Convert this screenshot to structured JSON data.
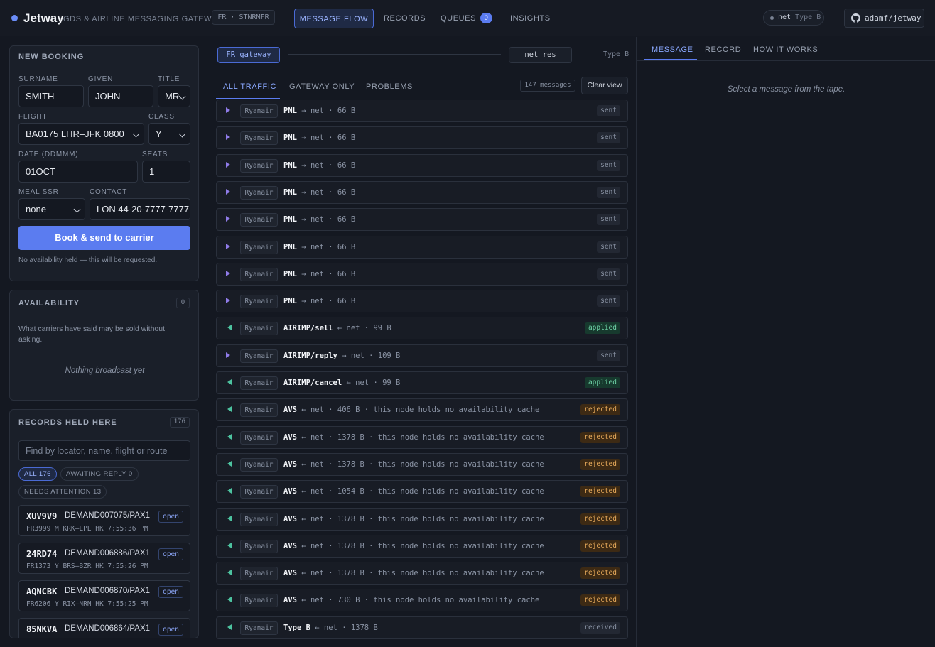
{
  "header": {
    "brand": "Jetway",
    "subtitle": "GDS & AIRLINE MESSAGING GATEWAY",
    "node": "FR · STNRMFR",
    "nav": [
      {
        "label": "MESSAGE FLOW",
        "active": true
      },
      {
        "label": "RECORDS"
      },
      {
        "label": "QUEUES",
        "badge": "0"
      },
      {
        "label": "INSIGHTS"
      }
    ],
    "net_label": "net",
    "net_type": "Type B",
    "repo": "adamf/jetway"
  },
  "new_booking": {
    "title": "NEW BOOKING",
    "surname_label": "SURNAME",
    "surname": "SMITH",
    "given_label": "GIVEN",
    "given": "JOHN",
    "title_label": "TITLE",
    "title_value": "MR",
    "flight_label": "FLIGHT",
    "flight": "BA0175 LHR–JFK 0800",
    "class_label": "CLASS",
    "class_value": "Y",
    "date_label": "DATE (DDMMM)",
    "date": "01OCT",
    "seats_label": "SEATS",
    "seats": "1",
    "meal_label": "MEAL SSR",
    "meal": "none",
    "contact_label": "CONTACT",
    "contact": "LON 44-20-7777-7777",
    "submit": "Book & send to carrier",
    "hint": "No availability held — this will be requested."
  },
  "availability": {
    "title": "AVAILABILITY",
    "count": "0",
    "description": "What carriers have said may be sold without asking.",
    "empty": "Nothing broadcast yet"
  },
  "records": {
    "title": "RECORDS HELD HERE",
    "count": "176",
    "search_placeholder": "Find by locator, name, flight or route",
    "filters": [
      {
        "label": "ALL",
        "count": "176",
        "active": true
      },
      {
        "label": "AWAITING REPLY",
        "count": "0"
      },
      {
        "label": "NEEDS ATTENTION",
        "count": "13"
      }
    ],
    "items": [
      {
        "locator": "XUV9V9",
        "name": "DEMAND007075/PAX1",
        "detail": "FR3999 M KRK–LPL HK  7:55:36 PM",
        "status": "open"
      },
      {
        "locator": "24RD74",
        "name": "DEMAND006886/PAX1",
        "detail": "FR1373 Y BRS–BZR HK  7:55:26 PM",
        "status": "open"
      },
      {
        "locator": "AQNCBK",
        "name": "DEMAND006870/PAX1",
        "detail": "FR6206 Y RIX–NRN HK  7:55:25 PM",
        "status": "open"
      },
      {
        "locator": "85NKVA",
        "name": "DEMAND006864/PAX1",
        "detail": "",
        "status": "open"
      }
    ]
  },
  "flow": {
    "gateway": "FR gateway",
    "res": "net res",
    "type": "Type B",
    "tabs": [
      {
        "label": "ALL TRAFFIC",
        "active": true
      },
      {
        "label": "GATEWAY ONLY"
      },
      {
        "label": "PROBLEMS"
      }
    ],
    "message_count": "147 messages",
    "clear": "Clear view",
    "messages": [
      {
        "dir": "out",
        "carrier": "Ryanair",
        "kind": "PNL",
        "detail": "→ net · 66 B",
        "status": "sent"
      },
      {
        "dir": "out",
        "carrier": "Ryanair",
        "kind": "PNL",
        "detail": "→ net · 66 B",
        "status": "sent"
      },
      {
        "dir": "out",
        "carrier": "Ryanair",
        "kind": "PNL",
        "detail": "→ net · 66 B",
        "status": "sent"
      },
      {
        "dir": "out",
        "carrier": "Ryanair",
        "kind": "PNL",
        "detail": "→ net · 66 B",
        "status": "sent"
      },
      {
        "dir": "out",
        "carrier": "Ryanair",
        "kind": "PNL",
        "detail": "→ net · 66 B",
        "status": "sent"
      },
      {
        "dir": "out",
        "carrier": "Ryanair",
        "kind": "PNL",
        "detail": "→ net · 66 B",
        "status": "sent"
      },
      {
        "dir": "out",
        "carrier": "Ryanair",
        "kind": "PNL",
        "detail": "→ net · 66 B",
        "status": "sent"
      },
      {
        "dir": "out",
        "carrier": "Ryanair",
        "kind": "PNL",
        "detail": "→ net · 66 B",
        "status": "sent"
      },
      {
        "dir": "in",
        "carrier": "Ryanair",
        "kind": "AIRIMP/sell",
        "detail": "← net · 99 B",
        "status": "applied"
      },
      {
        "dir": "out",
        "carrier": "Ryanair",
        "kind": "AIRIMP/reply",
        "detail": "→ net · 109 B",
        "status": "sent"
      },
      {
        "dir": "in",
        "carrier": "Ryanair",
        "kind": "AIRIMP/cancel",
        "detail": "← net · 99 B",
        "status": "applied"
      },
      {
        "dir": "in",
        "carrier": "Ryanair",
        "kind": "AVS",
        "detail": "← net · 406 B · this node holds no availability cache",
        "status": "rejected"
      },
      {
        "dir": "in",
        "carrier": "Ryanair",
        "kind": "AVS",
        "detail": "← net · 1378 B · this node holds no availability cache",
        "status": "rejected"
      },
      {
        "dir": "in",
        "carrier": "Ryanair",
        "kind": "AVS",
        "detail": "← net · 1378 B · this node holds no availability cache",
        "status": "rejected"
      },
      {
        "dir": "in",
        "carrier": "Ryanair",
        "kind": "AVS",
        "detail": "← net · 1054 B · this node holds no availability cache",
        "status": "rejected"
      },
      {
        "dir": "in",
        "carrier": "Ryanair",
        "kind": "AVS",
        "detail": "← net · 1378 B · this node holds no availability cache",
        "status": "rejected"
      },
      {
        "dir": "in",
        "carrier": "Ryanair",
        "kind": "AVS",
        "detail": "← net · 1378 B · this node holds no availability cache",
        "status": "rejected"
      },
      {
        "dir": "in",
        "carrier": "Ryanair",
        "kind": "AVS",
        "detail": "← net · 1378 B · this node holds no availability cache",
        "status": "rejected"
      },
      {
        "dir": "in",
        "carrier": "Ryanair",
        "kind": "AVS",
        "detail": "← net · 730 B · this node holds no availability cache",
        "status": "rejected"
      },
      {
        "dir": "in",
        "carrier": "Ryanair",
        "kind": "Type B",
        "detail": "← net · 1378 B",
        "status": "received"
      }
    ]
  },
  "detail": {
    "tabs": [
      {
        "label": "MESSAGE",
        "active": true
      },
      {
        "label": "RECORD"
      },
      {
        "label": "HOW IT WORKS"
      }
    ],
    "empty": "Select a message from the tape."
  },
  "colors": {
    "accent": "#5b7cf0",
    "background": "#141821",
    "applied": "#6ed3a6",
    "rejected": "#e6a95a"
  }
}
